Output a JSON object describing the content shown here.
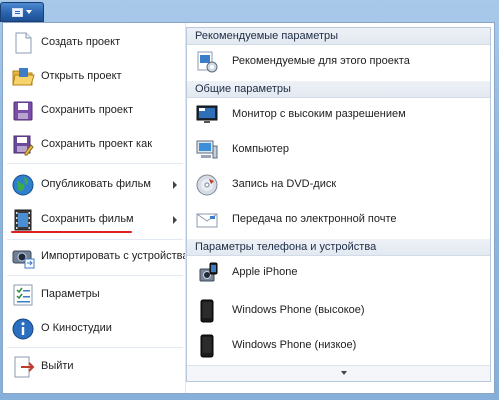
{
  "app_button": {
    "icon": "app-menu-icon"
  },
  "left_menu": {
    "items": [
      {
        "label": "Создать проект",
        "icon": "new-project-icon"
      },
      {
        "label": "Открыть проект",
        "icon": "open-folder-icon"
      },
      {
        "label": "Сохранить проект",
        "icon": "save-disk-icon"
      },
      {
        "label": "Сохранить проект как",
        "icon": "save-as-icon"
      },
      {
        "label": "Опубликовать фильм",
        "icon": "globe-publish-icon"
      },
      {
        "label": "Сохранить фильм",
        "icon": "film-save-icon"
      },
      {
        "label": "Импортировать с устройства",
        "icon": "camera-import-icon"
      },
      {
        "label": "Параметры",
        "icon": "options-list-icon"
      },
      {
        "label": "О Киностудии",
        "icon": "info-icon"
      },
      {
        "label": "Выйти",
        "icon": "exit-icon"
      }
    ]
  },
  "right_panel": {
    "recommended": {
      "header": "Рекомендуемые параметры",
      "items": [
        {
          "label": "Рекомендуемые для этого проекта",
          "icon": "recommended-settings-icon"
        }
      ]
    },
    "general": {
      "header": "Общие параметры",
      "items": [
        {
          "label": "Монитор с высоким разрешением",
          "icon": "hd-monitor-icon"
        },
        {
          "label": "Компьютер",
          "icon": "computer-icon"
        },
        {
          "label": "Запись на DVD-диск",
          "icon": "dvd-disc-icon"
        },
        {
          "label": "Передача по электронной почте",
          "icon": "email-icon"
        }
      ]
    },
    "devices": {
      "header": "Параметры телефона и устройства",
      "items": [
        {
          "label": "Apple iPhone",
          "icon": "iphone-icon"
        },
        {
          "label": "Windows Phone (высокое)",
          "icon": "windows-phone-icon"
        },
        {
          "label": "Windows Phone (низкое)",
          "icon": "windows-phone-icon"
        }
      ]
    }
  },
  "colors": {
    "highlight_underline": "#e02020",
    "accent_blue": "#2a63ae"
  }
}
